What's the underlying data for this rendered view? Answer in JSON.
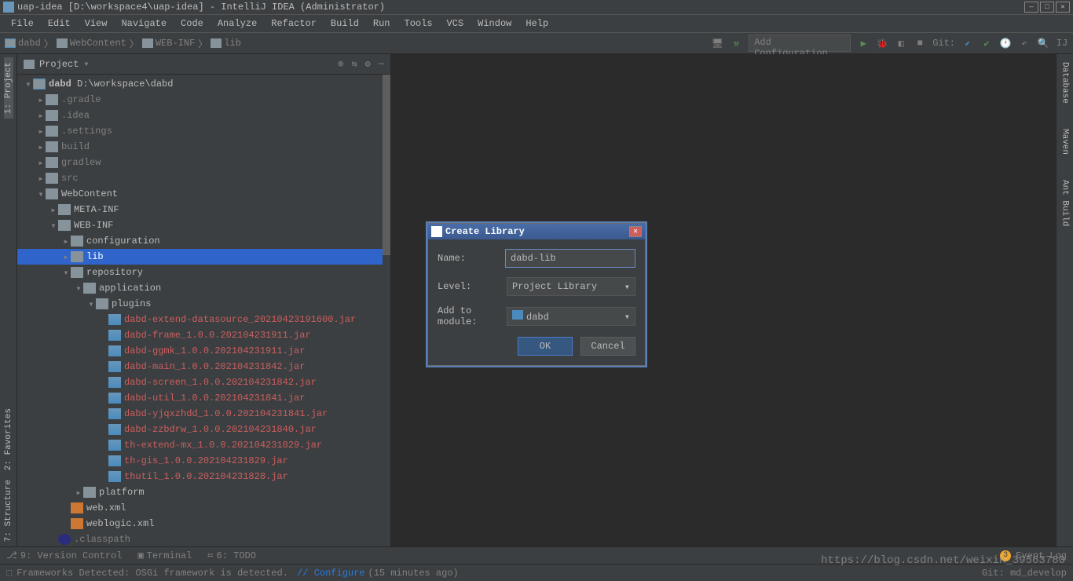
{
  "title": "uap-idea [D:\\workspace4\\uap-idea] - IntelliJ IDEA (Administrator)",
  "menu": [
    "File",
    "Edit",
    "View",
    "Navigate",
    "Code",
    "Analyze",
    "Refactor",
    "Build",
    "Run",
    "Tools",
    "VCS",
    "Window",
    "Help"
  ],
  "breadcrumb": [
    "dabd",
    "WebContent",
    "WEB-INF",
    "lib"
  ],
  "toolbar": {
    "config": "Add Configuration...",
    "git": "Git:"
  },
  "left_tabs": [
    "1: Project",
    "2: Favorites",
    "7: Structure"
  ],
  "right_tabs": [
    "Database",
    "Maven",
    "Ant Build"
  ],
  "panel": {
    "title": "Project"
  },
  "tree": {
    "root": {
      "name": "dabd",
      "path": "D:\\workspace\\dabd"
    },
    "folders": [
      ".gradle",
      ".idea",
      ".settings",
      "build",
      "gradlew",
      "src",
      "WebContent"
    ],
    "web": [
      "META-INF",
      "WEB-INF"
    ],
    "webinf": [
      "configuration",
      "lib",
      "repository"
    ],
    "repo": [
      "application"
    ],
    "app": [
      "plugins"
    ],
    "jars": [
      "dabd-extend-datasource_20210423191600.jar",
      "dabd-frame_1.0.0.202104231911.jar",
      "dabd-ggmk_1.0.0.202104231911.jar",
      "dabd-main_1.0.0.202104231842.jar",
      "dabd-screen_1.0.0.202104231842.jar",
      "dabd-util_1.0.0.202104231841.jar",
      "dabd-yjqxzhdd_1.0.0.202104231841.jar",
      "dabd-zzbdrw_1.0.0.202104231840.jar",
      "th-extend-mx_1.0.0.202104231829.jar",
      "th-gis_1.0.0.202104231829.jar",
      "thutil_1.0.0.202104231828.jar"
    ],
    "platform": "platform",
    "xmls": [
      "web.xml",
      "weblogic.xml"
    ],
    "classpath": ".classpath"
  },
  "dialog": {
    "title": "Create Library",
    "name_label": "Name:",
    "name_value": "dabd-lib",
    "level_label": "Level:",
    "level_value": "Project Library",
    "module_label": "Add to module:",
    "module_value": "dabd",
    "ok": "OK",
    "cancel": "Cancel"
  },
  "bottom": {
    "vcs": "9: Version Control",
    "terminal": "Terminal",
    "todo": "6: TODO",
    "event": "Event Log",
    "badge": "3"
  },
  "status": {
    "msg": "Frameworks Detected: OSGi framework is detected.",
    "configure": "// Configure",
    "time": "(15 minutes ago)",
    "git": "Git: md_develop"
  },
  "watermark": "https://blog.csdn.net/weixin_39563780"
}
